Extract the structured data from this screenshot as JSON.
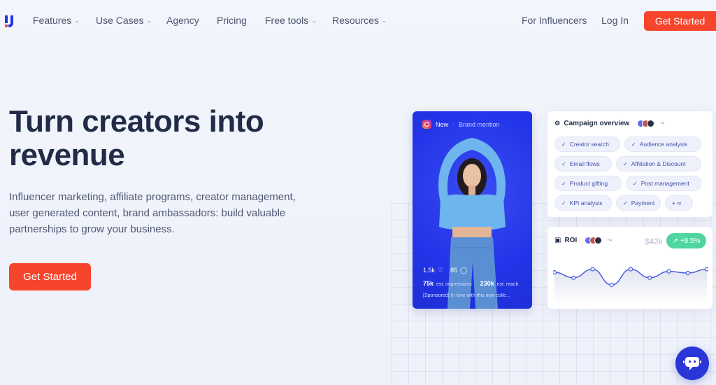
{
  "nav": {
    "items": [
      {
        "label": "Features",
        "dropdown": true
      },
      {
        "label": "Use Cases",
        "dropdown": true
      },
      {
        "label": "Agency",
        "dropdown": false
      },
      {
        "label": "Pricing",
        "dropdown": false
      },
      {
        "label": "Free tools",
        "dropdown": true
      },
      {
        "label": "Resources",
        "dropdown": true
      }
    ],
    "for_influencers": "For Influencers",
    "login": "Log In",
    "cta": "Get Started"
  },
  "hero": {
    "title": "Turn creators into revenue",
    "subtitle": "Influencer marketing, affiliate programs, creator management, user generated content, brand ambassadors: build valuable partnerships to grow your business.",
    "cta": "Get Started"
  },
  "post": {
    "status": "New",
    "type": "Brand mention",
    "likes": "1.5k",
    "comments": "85",
    "impressions": "75k",
    "impressions_label": "est. impressions",
    "reach": "230k",
    "reach_label": "est. reach",
    "caption": "[Sponsored] In love with this new colle..."
  },
  "campaign": {
    "title": "Campaign overview",
    "avatars_more": "+4",
    "chips": [
      "Creator search",
      "Audience analysis",
      "Email flows",
      "Affiliation & Discount",
      "Product gifting",
      "Post management",
      "KPI analysis",
      "Payment"
    ],
    "more_chip": "+ ∞"
  },
  "roi": {
    "title": "ROI",
    "avatars_more": "+4",
    "value": "$42k",
    "change": "+8.5%",
    "trend": [
      0.62,
      0.45,
      0.72,
      0.22,
      0.72,
      0.45,
      0.65,
      0.6,
      0.72
    ]
  },
  "colors": {
    "accent": "#f7452d",
    "brand_blue": "#2234e8",
    "positive": "#4fd6a0"
  }
}
